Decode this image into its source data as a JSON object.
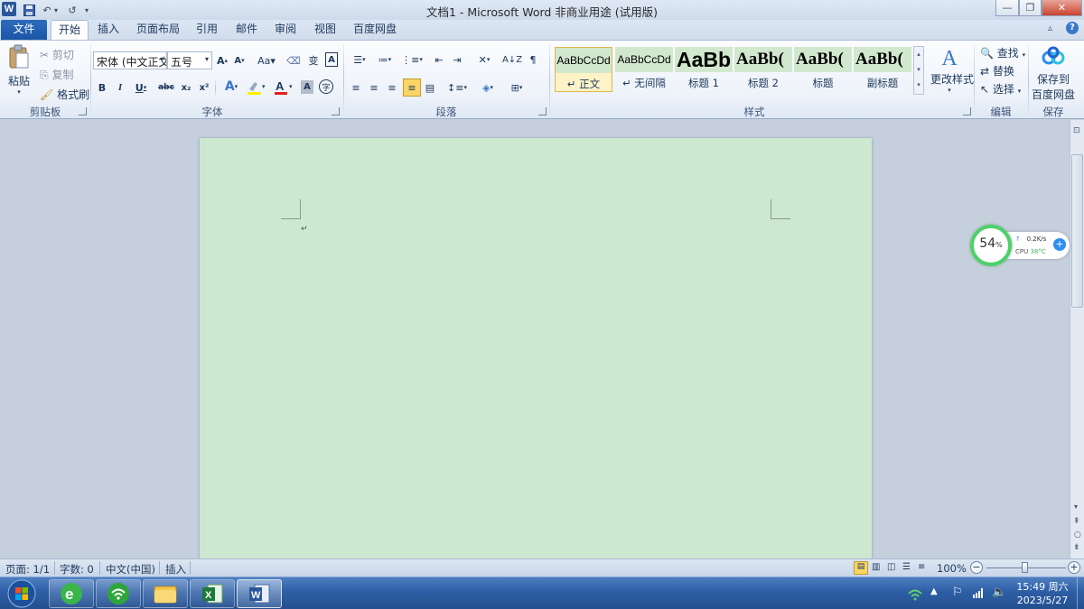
{
  "window": {
    "title": "文档1 - Microsoft Word 非商业用途 (试用版)",
    "app_icon_letter": "W"
  },
  "tabs": [
    {
      "label": "文件"
    },
    {
      "label": "开始"
    },
    {
      "label": "插入"
    },
    {
      "label": "页面布局"
    },
    {
      "label": "引用"
    },
    {
      "label": "邮件"
    },
    {
      "label": "审阅"
    },
    {
      "label": "视图"
    },
    {
      "label": "百度网盘"
    }
  ],
  "clipboard": {
    "paste": "粘贴",
    "cut": "剪切",
    "copy": "复制",
    "format_painter": "格式刷",
    "group_label": "剪贴板"
  },
  "font": {
    "font_name": "宋体 (中文正文",
    "font_size": "五号",
    "group_label": "字体"
  },
  "paragraph": {
    "group_label": "段落"
  },
  "styles": {
    "items": [
      {
        "preview": "AaBbCcDd",
        "name": "↵ 正文"
      },
      {
        "preview": "AaBbCcDd",
        "name": "↵ 无间隔"
      },
      {
        "preview": "AaBb",
        "name": "标题 1"
      },
      {
        "preview": "AaBb(",
        "name": "标题 2"
      },
      {
        "preview": "AaBb(",
        "name": "标题"
      },
      {
        "preview": "AaBb(",
        "name": "副标题"
      }
    ],
    "change_styles": "更改样式",
    "group_label": "样式"
  },
  "editing": {
    "find": "查找",
    "replace": "替换",
    "select": "选择",
    "group_label": "编辑"
  },
  "save": {
    "button_line1": "保存到",
    "button_line2": "百度网盘",
    "group_label": "保存"
  },
  "document": {
    "paragraph_mark": "↵",
    "background_color": "#cde8d1"
  },
  "status": {
    "page": "页面: 1/1",
    "words": "字数: 0",
    "language": "中文(中国)",
    "mode": "插入",
    "zoom": "100%"
  },
  "widget": {
    "percent": "54",
    "percent_sign": "%",
    "net_speed": "0.2K/s",
    "cpu_label": "CPU",
    "cpu_temp": "38°C"
  },
  "taskbar": {
    "time": "15:49 周六",
    "date": "2023/5/27"
  },
  "colors": {
    "accent": "#2b579a",
    "file_tab": "#1b56a6",
    "style_selected": "#f7d86e"
  }
}
